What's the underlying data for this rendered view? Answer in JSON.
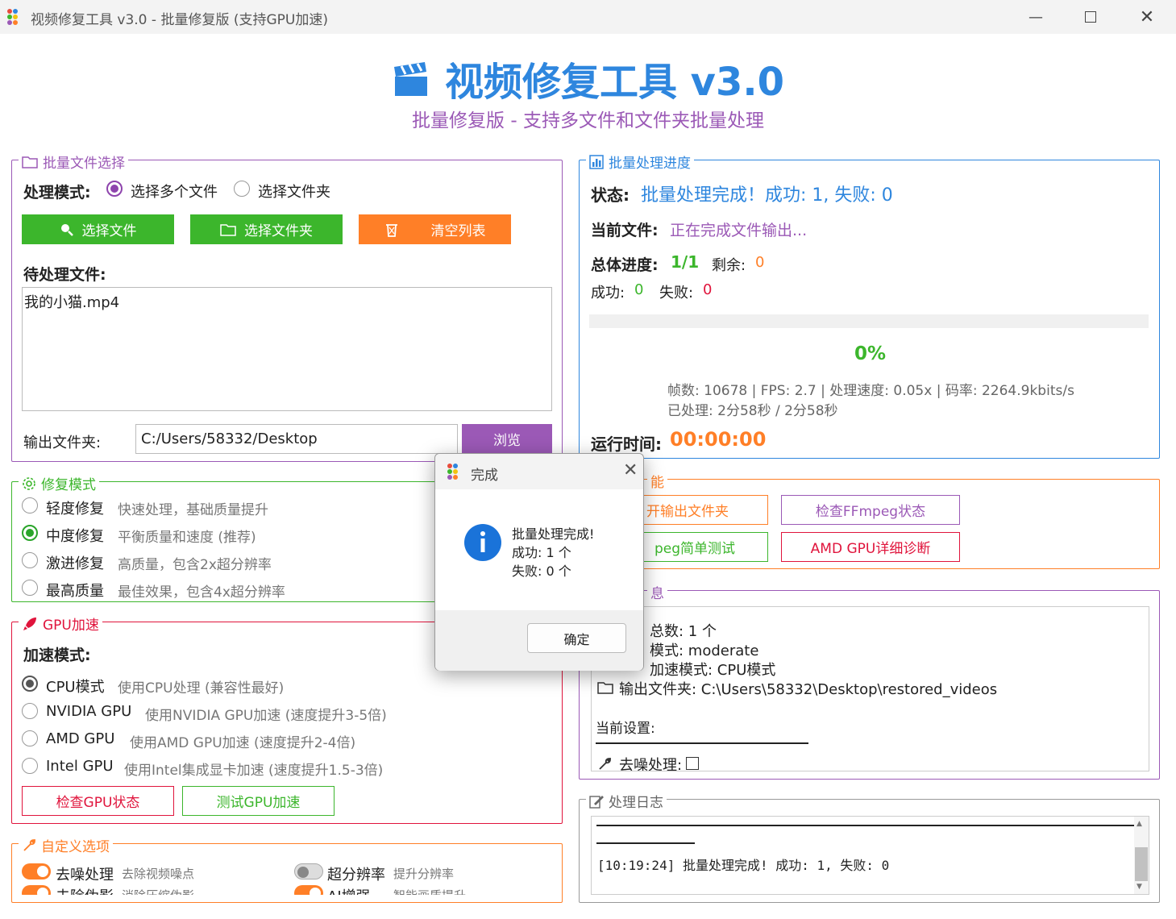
{
  "window": {
    "title": "视频修复工具 v3.0 - 批量修复版 (支持GPU加速)"
  },
  "header": {
    "title": "视频修复工具 v3.0",
    "subtitle": "批量修复版 - 支持多文件和文件夹批量处理"
  },
  "file_select": {
    "legend": "批量文件选择",
    "mode_label": "处理模式:",
    "mode_options": [
      "选择多个文件",
      "选择文件夹"
    ],
    "mode_selected": "选择多个文件",
    "btn_select_files": "选择文件",
    "btn_select_folder": "选择文件夹",
    "btn_clear": "清空列表",
    "pending_label": "待处理文件:",
    "pending_files": [
      "我的小猫.mp4"
    ],
    "output_label": "输出文件夹:",
    "output_value": "C:/Users/58332/Desktop",
    "btn_browse": "浏览"
  },
  "repair_mode": {
    "legend": "修复模式",
    "options": [
      {
        "label": "轻度修复",
        "desc": "快速处理，基础质量提升"
      },
      {
        "label": "中度修复",
        "desc": "平衡质量和速度 (推荐)"
      },
      {
        "label": "激进修复",
        "desc": "高质量，包含2x超分辨率"
      },
      {
        "label": "最高质量",
        "desc": "最佳效果，包含4x超分辨率"
      }
    ],
    "selected": "中度修复"
  },
  "gpu": {
    "legend": "GPU加速",
    "mode_label": "加速模式:",
    "options": [
      {
        "label": "CPU模式",
        "desc": "使用CPU处理 (兼容性最好)"
      },
      {
        "label": "NVIDIA GPU",
        "desc": "使用NVIDIA GPU加速 (速度提升3-5倍)"
      },
      {
        "label": "AMD GPU",
        "desc": "使用AMD GPU加速 (速度提升2-4倍)"
      },
      {
        "label": "Intel GPU",
        "desc": "使用Intel集成显卡加速 (速度提升1.5-3倍)"
      }
    ],
    "selected": "CPU模式",
    "btn_check": "检查GPU状态",
    "btn_test": "测试GPU加速"
  },
  "custom": {
    "legend": "自定义选项",
    "items": [
      {
        "label": "去噪处理",
        "desc": "去除视频噪点",
        "on": true
      },
      {
        "label": "超分辨率",
        "desc": "提升分辨率",
        "on": false
      },
      {
        "label": "去除伪影",
        "desc": "消除压缩伪影",
        "on": true
      },
      {
        "label": "AI增强",
        "desc": "智能画质提升",
        "on": true
      }
    ]
  },
  "progress": {
    "legend": "批量处理进度",
    "status_label": "状态:",
    "status_value": "批量处理完成！成功: 1, 失败: 0",
    "current_label": "当前文件:",
    "current_value": "正在完成文件输出...",
    "overall_label": "总体进度:",
    "overall_value": "1/1",
    "remain_label": "剩余:",
    "remain_value": "0",
    "success_label": "成功:",
    "success_value": "0",
    "fail_label": "失败:",
    "fail_value": "0",
    "percent": "0%",
    "percent_fraction": 0,
    "stats_line": "帧数: 10678 | FPS: 2.7 | 处理速度: 0.05x | 码率: 2264.9kbits/s",
    "processed_line": "已处理: 2分58秒 / 2分58秒",
    "runtime_label": "运行时间:",
    "runtime_value": "00:00:00"
  },
  "tools": {
    "legend_visible": "能",
    "btn_open_output": "开输出文件夹",
    "btn_ffmpeg_status": "检查FFmpeg状态",
    "btn_ffmpeg_test": "peg简单测试",
    "btn_amd_diag": "AMD GPU详细诊断"
  },
  "info": {
    "legend_visible": "息",
    "lines": [
      "总数: 1 个",
      "模式: moderate",
      "加速模式: CPU模式",
      "输出文件夹: C:\\Users\\58332\\Desktop\\restored_videos"
    ],
    "settings_label": "当前设置:",
    "partial_line": "去噪处理:"
  },
  "log": {
    "legend": "处理日志",
    "line": "[10:19:24] 批量处理完成! 成功: 1, 失败: 0"
  },
  "dialog": {
    "title": "完成",
    "message_lines": [
      "批量处理完成!",
      "成功: 1 个",
      "失败: 0 个"
    ],
    "ok": "确定"
  },
  "colors": {
    "green": "#3cb62c",
    "orange": "#ff7f27",
    "purple": "#9b59b6",
    "blue": "#2e86de",
    "red": "#e0143c"
  }
}
